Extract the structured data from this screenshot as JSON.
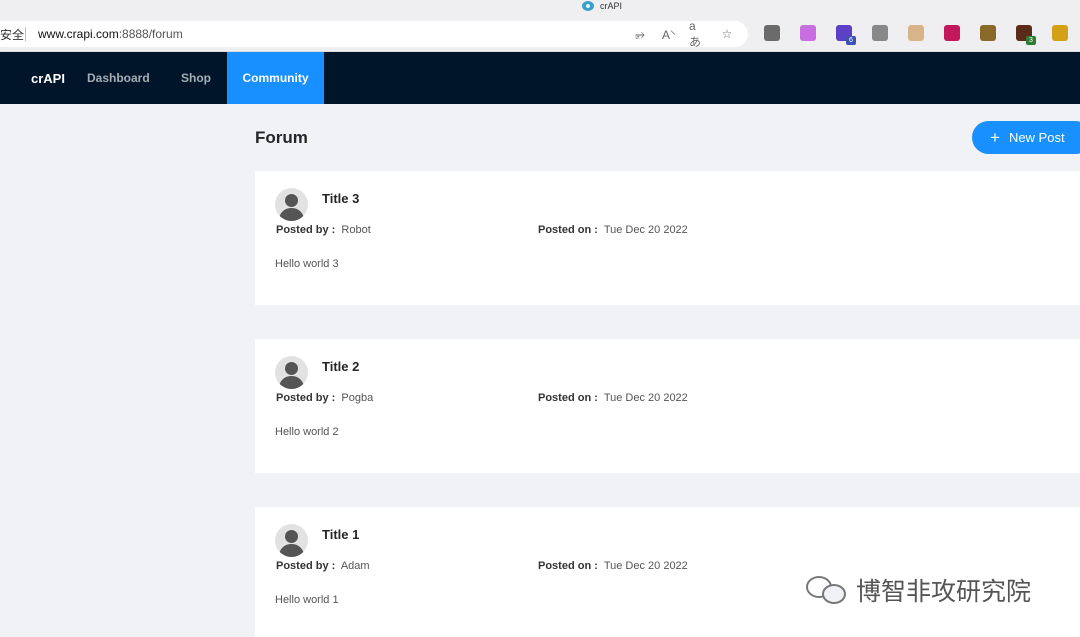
{
  "browser": {
    "tab_title": "crAPI",
    "security_label": "安全",
    "url_host": "www.crapi.com",
    "url_rest": ":8888/forum",
    "extensions": [
      {
        "name": "collections-icon",
        "color": "#6b6b6b"
      },
      {
        "name": "purple-circle-icon",
        "color": "#c86ee0"
      },
      {
        "name": "cube-extension-icon",
        "color": "#5b3fc4",
        "badge": "6"
      },
      {
        "name": "panda-extension-icon",
        "color": "#888888"
      },
      {
        "name": "diamond-extension-icon",
        "color": "#d9b48a"
      },
      {
        "name": "h-extension-icon",
        "color": "#c2185b"
      },
      {
        "name": "pilcrow-extension-icon",
        "color": "#8a6a2a"
      },
      {
        "name": "dark-extension-icon",
        "color": "#5a2a1a",
        "badge": "3"
      },
      {
        "name": "bee-extension-icon",
        "color": "#d4a017"
      }
    ]
  },
  "nav": {
    "brand": "crAPI",
    "items": [
      "Dashboard",
      "Shop",
      "Community"
    ],
    "active": "Community"
  },
  "forum": {
    "title": "Forum",
    "new_post": "New Post",
    "posted_by_label": "Posted by :",
    "posted_on_label": "Posted on :",
    "posts": [
      {
        "title": "Title 3",
        "author": "Robot",
        "date": "Tue Dec 20 2022",
        "content": "Hello world 3"
      },
      {
        "title": "Title 2",
        "author": "Pogba",
        "date": "Tue Dec 20 2022",
        "content": "Hello world 2"
      },
      {
        "title": "Title 1",
        "author": "Adam",
        "date": "Tue Dec 20 2022",
        "content": "Hello world 1"
      }
    ]
  },
  "watermark": {
    "text": "博智非攻研究院"
  },
  "colors": {
    "nav_bg": "#001529",
    "accent": "#1890ff",
    "page_bg": "#f0f2f5"
  }
}
